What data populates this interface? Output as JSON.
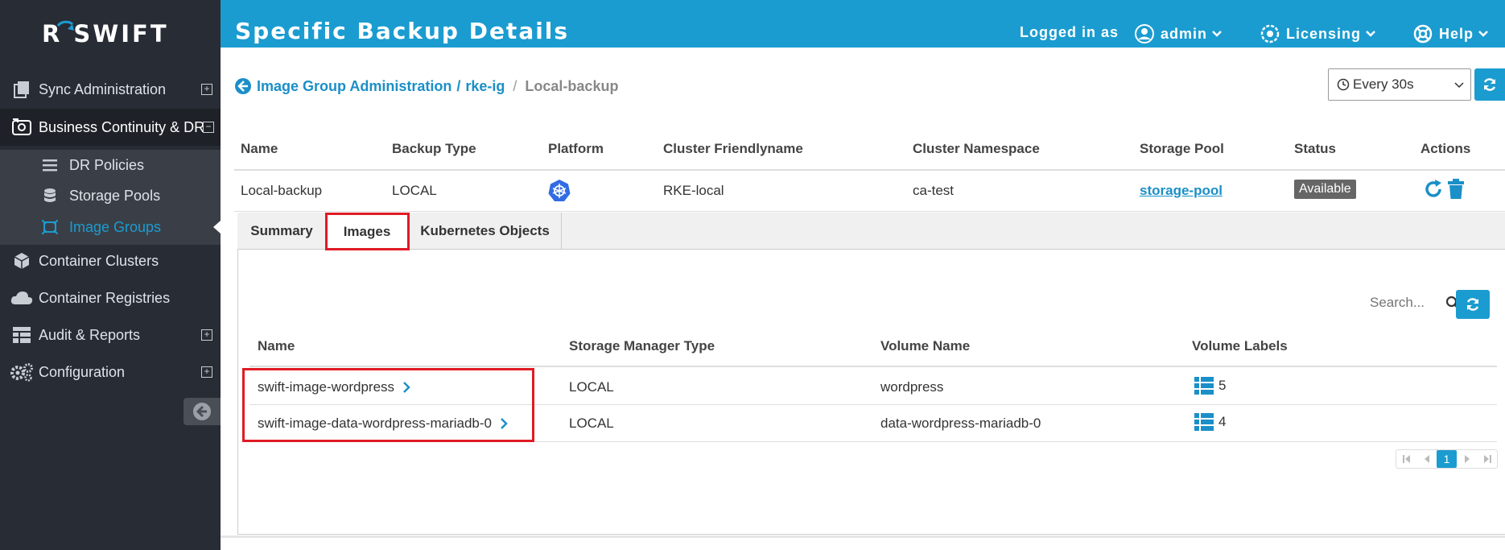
{
  "brand": {
    "logo_text": "SWIFT",
    "logo_letter": "R"
  },
  "sidebar": {
    "items": [
      {
        "label": "Sync Administration",
        "icon": "copy-icon",
        "expandable": true
      },
      {
        "label": "Business Continuity & DR",
        "icon": "backup-icon",
        "expandable": true,
        "expanded": true
      },
      {
        "label": "Container Clusters",
        "icon": "cube-icon",
        "expandable": false
      },
      {
        "label": "Container Registries",
        "icon": "cloud-icon",
        "expandable": false
      },
      {
        "label": "Audit & Reports",
        "icon": "table-icon",
        "expandable": true
      },
      {
        "label": "Configuration",
        "icon": "gears-icon",
        "expandable": true
      }
    ],
    "subitems": [
      {
        "label": "DR Policies",
        "icon": "list-icon"
      },
      {
        "label": "Storage Pools",
        "icon": "database-icon"
      },
      {
        "label": "Image Groups",
        "icon": "image-group-icon",
        "current": true
      }
    ]
  },
  "header": {
    "title": "Specific Backup Details",
    "logged_in_label": "Logged in as",
    "user": "admin",
    "licensing": "Licensing",
    "help": "Help"
  },
  "breadcrumb": {
    "parent": "Image Group Administration",
    "separator": "/",
    "group": "rke-ig",
    "current": "Local-backup"
  },
  "refresh": {
    "interval": "Every 30s"
  },
  "backup_table": {
    "columns": [
      "Name",
      "Backup Type",
      "Platform",
      "Cluster Friendlyname",
      "Cluster Namespace",
      "Storage Pool",
      "Status",
      "Actions"
    ],
    "row": {
      "name": "Local-backup",
      "backup_type": "LOCAL",
      "platform_icon": "kubernetes-icon",
      "cluster_friendlyname": "RKE-local",
      "cluster_namespace": "ca-test",
      "storage_pool": "storage-pool",
      "status": "Available"
    }
  },
  "tabs": [
    {
      "label": "Summary"
    },
    {
      "label": "Images",
      "active": true
    },
    {
      "label": "Kubernetes Objects"
    }
  ],
  "search": {
    "placeholder": "Search..."
  },
  "images_table": {
    "columns": [
      "Name",
      "Storage Manager Type",
      "Volume Name",
      "Volume Labels"
    ],
    "rows": [
      {
        "name": "swift-image-wordpress",
        "storage_manager_type": "LOCAL",
        "volume_name": "wordpress",
        "volume_labels": "5"
      },
      {
        "name": "swift-image-data-wordpress-mariadb-0",
        "storage_manager_type": "LOCAL",
        "volume_name": "data-wordpress-mariadb-0",
        "volume_labels": "4"
      }
    ]
  },
  "pagination": {
    "current_page": "1"
  },
  "colors": {
    "accent": "#1b9cd0",
    "sidebar_bg": "#272c35",
    "highlight": "#e01b24"
  }
}
